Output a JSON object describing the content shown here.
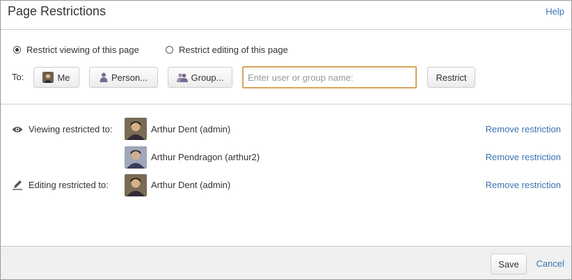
{
  "header": {
    "title": "Page Restrictions",
    "help": "Help"
  },
  "options": {
    "restrict_viewing": {
      "label": "Restrict viewing of this page",
      "checked": true
    },
    "restrict_editing": {
      "label": "Restrict editing of this page",
      "checked": false
    }
  },
  "picker": {
    "to_label": "To:",
    "me_label": "Me",
    "person_label": "Person...",
    "group_label": "Group...",
    "input_placeholder": "Enter user or group name:",
    "input_value": "",
    "restrict_label": "Restrict"
  },
  "restrictions": {
    "viewing_label": "Viewing restricted to:",
    "editing_label": "Editing restricted to:",
    "viewing_users": [
      {
        "name": "Arthur Dent (admin)",
        "action": "Remove restriction"
      },
      {
        "name": "Arthur Pendragon (arthur2)",
        "action": "Remove restriction"
      }
    ],
    "editing_users": [
      {
        "name": "Arthur Dent (admin)",
        "action": "Remove restriction"
      }
    ]
  },
  "footer": {
    "save": "Save",
    "cancel": "Cancel"
  },
  "colors": {
    "link": "#3b73af",
    "input_focus": "#d8a45a",
    "footer_bg": "#f0f0f0"
  }
}
